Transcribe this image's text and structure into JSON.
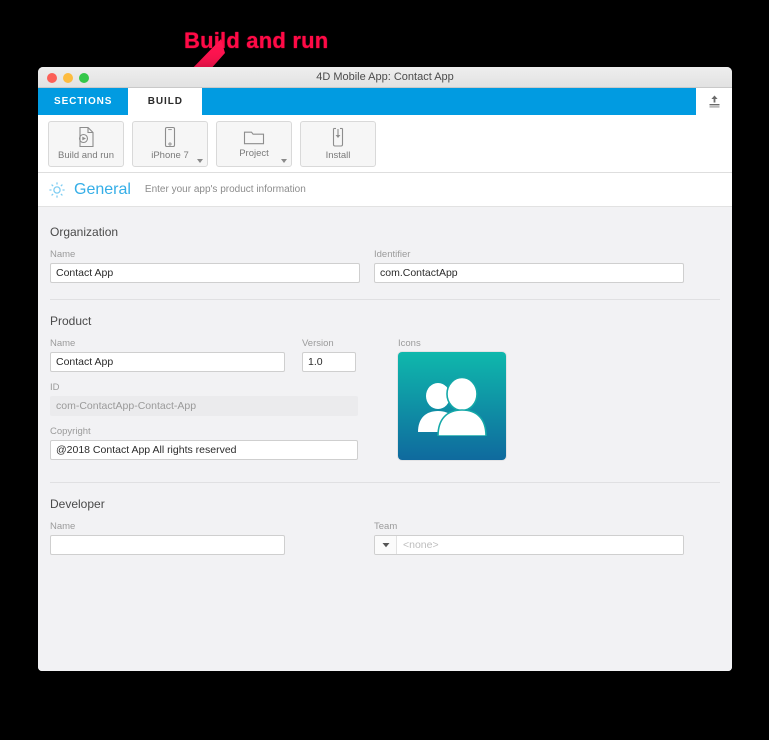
{
  "annotation": {
    "label": "Build and run",
    "color": "#ff0a46",
    "arrow_icon": "down-left-arrow-icon"
  },
  "window": {
    "title": "4D Mobile App: Contact App",
    "traffic_lights": [
      "close",
      "minimize",
      "zoom"
    ]
  },
  "tabs": [
    {
      "id": "sections",
      "label": "SECTIONS",
      "active": false
    },
    {
      "id": "build",
      "label": "BUILD",
      "active": true
    }
  ],
  "upload_button": {
    "icon": "upload-icon",
    "label": ""
  },
  "toolbar": {
    "buttons": [
      {
        "id": "build-and-run",
        "label": "Build and run",
        "icon": "document-play-icon",
        "has_caret": false
      },
      {
        "id": "device",
        "label": "iPhone 7",
        "icon": "phone-icon",
        "has_caret": true
      },
      {
        "id": "project",
        "label": "Project",
        "icon": "folder-icon",
        "has_caret": true
      },
      {
        "id": "install",
        "label": "Install",
        "icon": "phone-download-icon",
        "has_caret": false
      }
    ]
  },
  "section": {
    "icon": "gear-icon",
    "title": "General",
    "subtitle": "Enter your app's product information",
    "accent_color": "#35aee7"
  },
  "form": {
    "organization": {
      "group_label": "Organization",
      "name_label": "Name",
      "name_value": "Contact App",
      "name_placeholder": "",
      "identifier_label": "Identifier",
      "identifier_value": "com.ContactApp",
      "identifier_placeholder": ""
    },
    "product": {
      "group_label": "Product",
      "name_label": "Name",
      "name_value": "Contact App",
      "version_label": "Version",
      "version_value": "1.0",
      "icons_label": "Icons",
      "icon_image": "contacts-app-icon",
      "id_label": "ID",
      "id_value": "com-ContactApp-Contact-App",
      "copyright_label": "Copyright",
      "copyright_value": "@2018 Contact App All rights reserved"
    },
    "developer": {
      "group_label": "Developer",
      "name_label": "Name",
      "name_value": "",
      "name_placeholder": "",
      "team_label": "Team",
      "team_value": "",
      "team_placeholder": "<none>"
    }
  }
}
